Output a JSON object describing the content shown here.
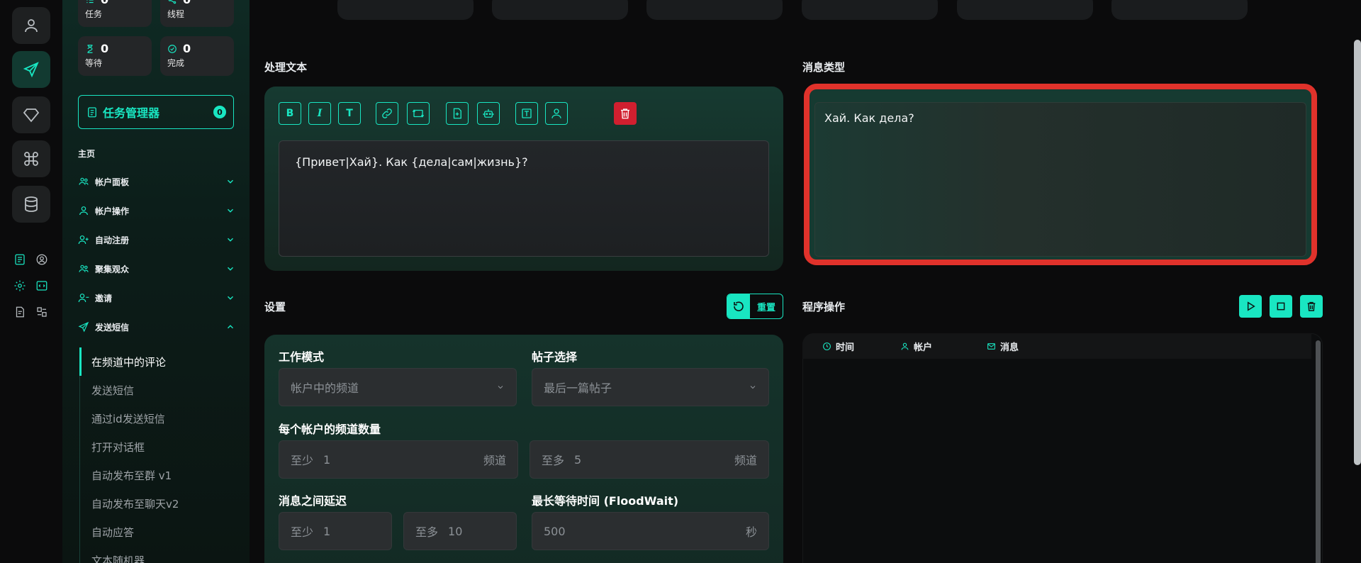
{
  "rail": {
    "buttons": [
      "user-icon",
      "send-icon",
      "diamond-icon",
      "command-icon",
      "database-icon"
    ],
    "minis": [
      "list-icon",
      "user-circle-icon",
      "gear-icon",
      "code-icon",
      "file-icon",
      "layout-icon"
    ]
  },
  "sidebar": {
    "stats": [
      {
        "value": "0",
        "label": "任务",
        "icon": "list-check-icon"
      },
      {
        "value": "0",
        "label": "线程",
        "icon": "share-icon"
      },
      {
        "value": "0",
        "label": "等待",
        "icon": "hourglass-icon"
      },
      {
        "value": "0",
        "label": "完成",
        "icon": "check-circle-icon"
      }
    ],
    "task_manager": {
      "label": "任务管理器",
      "count": "0"
    },
    "section": "主页",
    "nav": [
      {
        "label": "帐户面板",
        "icon": "users-icon"
      },
      {
        "label": "帐户操作",
        "icon": "user-icon"
      },
      {
        "label": "自动注册",
        "icon": "user-plus-icon"
      },
      {
        "label": "聚集观众",
        "icon": "users-icon"
      },
      {
        "label": "邀请",
        "icon": "user-add-icon"
      },
      {
        "label": "发送短信",
        "icon": "send-icon"
      }
    ],
    "subnav": [
      "在频道中的评论",
      "发送短信",
      "通过id发送短信",
      "打开对话框",
      "自动发布至群 v1",
      "自动发布至聊天v2",
      "自动应答",
      "文本随机器"
    ]
  },
  "main": {
    "process_text_label": "处理文本",
    "message_type_label": "消息类型",
    "toolbar": {
      "bold": "B",
      "italic": "I",
      "text": "T"
    },
    "editor_text": "{Привет|Хай}. Как {дела|сам|жизнь}?",
    "preview_text": "Хай. Как дела?",
    "settings_label": "设置",
    "reset_label": "重置",
    "program_ops_label": "程序操作",
    "work_mode": {
      "label": "工作模式",
      "value": "帐户中的频道"
    },
    "post_select": {
      "label": "帖子选择",
      "value": "最后一篇帖子"
    },
    "channels_per_account": {
      "label": "每个帐户的频道数量",
      "min_prefix": "至少",
      "min": "1",
      "max_prefix": "至多",
      "max": "5",
      "unit": "频道"
    },
    "delay": {
      "label": "消息之间延迟",
      "min_prefix": "至少",
      "min": "1",
      "max_prefix": "至多",
      "max": "10"
    },
    "floodwait": {
      "label": "最长等待时间 (FloodWait)",
      "value": "500",
      "unit": "秒"
    },
    "log_columns": [
      {
        "label": "时间",
        "icon": "clock-icon"
      },
      {
        "label": "帐户",
        "icon": "user-icon"
      },
      {
        "label": "消息",
        "icon": "mail-icon"
      }
    ]
  },
  "colors": {
    "accent": "#19e6c2",
    "danger": "#d11f2f",
    "highlight": "#e0322b"
  }
}
